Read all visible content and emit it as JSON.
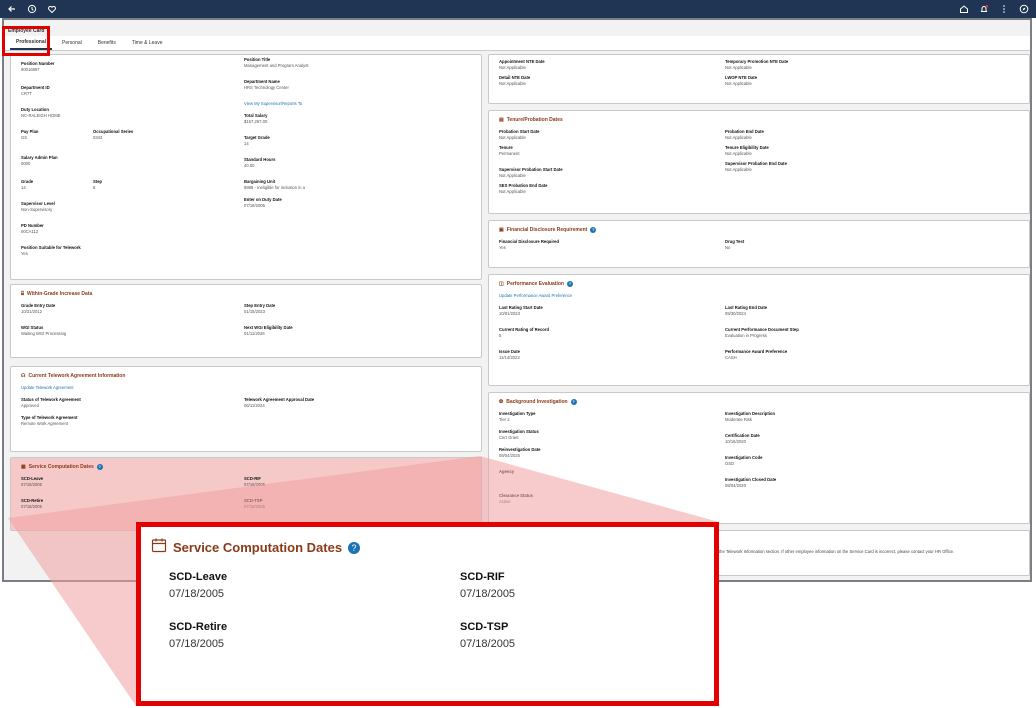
{
  "app": {
    "subtitle": "Employee Card"
  },
  "tabs": [
    "Professional",
    "Personal",
    "Benefits",
    "Time & Leave"
  ],
  "position": {
    "f1": {
      "label": "Position Number",
      "value": "90016967"
    },
    "f2": {
      "label": "Department ID",
      "value": "CR7T"
    },
    "f3": {
      "label": "Duty Location",
      "value": "NC-RALEIGH HOME"
    },
    "f4": {
      "label": "Pay Plan",
      "value": "GS"
    },
    "f5": {
      "label": "Occupational Series",
      "value": "0343"
    },
    "f6": {
      "label": "Salary Admin Plan",
      "value": "0000"
    },
    "f7": {
      "label": "Grade",
      "value": "14"
    },
    "f8": {
      "label": "Step",
      "value": "8"
    },
    "f9": {
      "label": "Supervisor Level",
      "value": "Non-Supervisory"
    },
    "f10": {
      "label": "PD Number",
      "value": "00CA112"
    },
    "f11": {
      "label": "Position Suitable for Telework",
      "value": "Yes"
    },
    "f12": {
      "label": "Position Title",
      "value": "Management and Program Analyst"
    },
    "f13": {
      "label": "Department Name",
      "value": "HRS Technology Center"
    },
    "link": "View My Supervisor/Reports To",
    "f14": {
      "label": "Total Salary",
      "value": "$157,267.00"
    },
    "f15": {
      "label": "Target Grade",
      "value": "14"
    },
    "f16": {
      "label": "Standard Hours",
      "value": "40.00"
    },
    "f17": {
      "label": "Bargaining Unit",
      "value": "8888 - Ineligible for inclusion in a"
    },
    "f18": {
      "label": "Enter on Duty Date",
      "value": "07/18/2005"
    }
  },
  "wgi": {
    "title": "Within-Grade Increase Data",
    "f1": {
      "label": "Grade Entry Date",
      "value": "10/21/2012"
    },
    "f2": {
      "label": "WGI Status",
      "value": "Waiting WGI Processing"
    },
    "f3": {
      "label": "Step Entry Date",
      "value": "01/15/2023"
    },
    "f4": {
      "label": "Next WGI Eligibility Date",
      "value": "01/11/2026"
    }
  },
  "telework": {
    "title": "Current Telework Agreement Information",
    "link": "Update Telework Agreement",
    "f1": {
      "label": "Status of Telework Agreement",
      "value": "Approved"
    },
    "f2": {
      "label": "Type of Telework Agreement",
      "value": "Remote Work Agreement"
    },
    "f3": {
      "label": "Telework Agreement Approval Date",
      "value": "06/11/2024"
    }
  },
  "scd": {
    "title": "Service Computation Dates",
    "leave": {
      "label": "SCD-Leave",
      "value": "07/18/2005"
    },
    "retire": {
      "label": "SCD-Retire",
      "value": "07/18/2005"
    },
    "rif": {
      "label": "SCD-RIF",
      "value": "07/18/2005"
    },
    "tsp": {
      "label": "SCD-TSP",
      "value": "07/18/2005"
    }
  },
  "appt": {
    "f1": {
      "label": "Appointment NTE Date",
      "value": "Not Applicable"
    },
    "f2": {
      "label": "Detail NTE Date",
      "value": "Not Applicable"
    },
    "f3": {
      "label": "Temporary Promotion NTE Date",
      "value": "Not Applicable"
    },
    "f4": {
      "label": "LWOP NTE Date",
      "value": "Not Applicable"
    }
  },
  "tenure": {
    "title": "Tenure/Probation Dates",
    "f1": {
      "label": "Probation Start Date",
      "value": "Not Applicable"
    },
    "f2": {
      "label": "Tenure",
      "value": "Permanent"
    },
    "f3": {
      "label": "Supervisor Probation Start Date",
      "value": "Not Applicable"
    },
    "f4": {
      "label": "SES Probation End Date",
      "value": "Not Applicable"
    },
    "f5": {
      "label": "Probation End Date",
      "value": "Not Applicable"
    },
    "f6": {
      "label": "Tenure Eligibility Date",
      "value": "Not Applicable"
    },
    "f7": {
      "label": "Supervisor Probation End Date",
      "value": "Not Applicable"
    }
  },
  "financial": {
    "title": "Financial Disclosure Requirement",
    "f1": {
      "label": "Financial Disclosure Required",
      "value": "Yes"
    },
    "f2": {
      "label": "Drug Test",
      "value": "No"
    }
  },
  "perf": {
    "title": "Performance Evaluation",
    "link": "Update Performance Award Preference",
    "f1": {
      "label": "Last Rating Start Date",
      "value": "10/01/2023"
    },
    "f2": {
      "label": "Current Rating of Record",
      "value": "5"
    },
    "f3": {
      "label": "Issue Date",
      "value": "11/14/2023"
    },
    "f4": {
      "label": "Last Rating End Date",
      "value": "09/30/2024"
    },
    "f5": {
      "label": "Current Performance Document Step",
      "value": "Evaluation in Progress"
    },
    "f6": {
      "label": "Performance Award Preference",
      "value": "CASH"
    }
  },
  "bi": {
    "title": "Background Investigation",
    "f1": {
      "label": "Investigation Type",
      "value": "Tier 2"
    },
    "f2": {
      "label": "Investigation Status",
      "value": "Cert Grant"
    },
    "f3": {
      "label": "Reinvestigation Date",
      "value": "08/04/2025"
    },
    "f4": {
      "label": "Agency",
      "value": ""
    },
    "f5": {
      "label": "Clearance Status",
      "value": "Active"
    },
    "f6": {
      "label": "Investigation Description",
      "value": "Moderate Risk"
    },
    "f7": {
      "label": "Certification Date",
      "value": "10/16/2020"
    },
    "f8": {
      "label": "Investigation Code",
      "value": "OSD"
    },
    "f9": {
      "label": "Investigation Closed Date",
      "value": "08/04/2020"
    }
  },
  "footnote": "the Telework Information section. If other employee information on the Service Card is incorrect, please contact your HR Office.",
  "colors": {
    "accent": "#8b3a18",
    "link": "#1b73b3",
    "highlight": "#e00000",
    "topbar": "#1f3553"
  }
}
